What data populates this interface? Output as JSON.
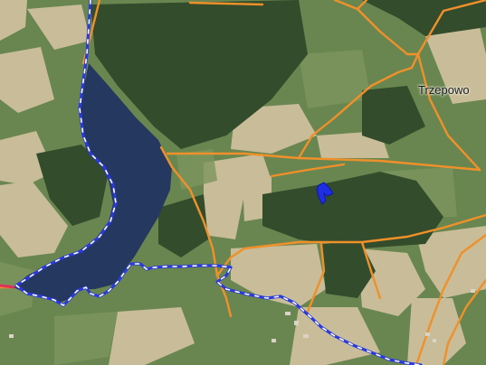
{
  "map": {
    "place_label": "Trzepowo",
    "colors": {
      "road": "#f0902a",
      "boundary": "#2a3adc",
      "boundary_dash": "#ffffff",
      "lake": "#25385f",
      "forest": "#2f4a2a",
      "field_light": "#c9bd97",
      "meadow": "#6e8a52",
      "parcel": "#1f2ee0",
      "edge_marker": "#e0305a"
    }
  }
}
